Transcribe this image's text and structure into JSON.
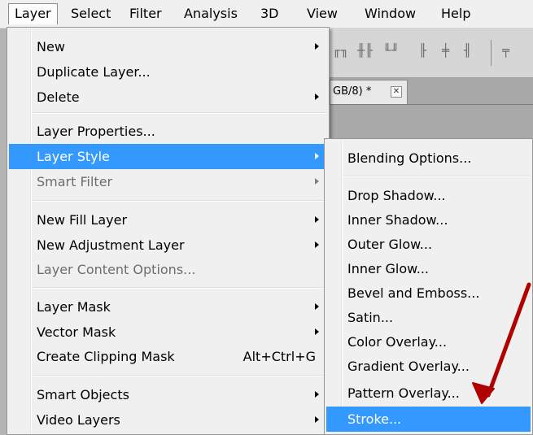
{
  "menubar": {
    "items": [
      "Layer",
      "Select",
      "Filter",
      "Analysis",
      "3D",
      "View",
      "Window",
      "Help"
    ],
    "active": "Layer"
  },
  "document_tab": {
    "title": "GB/8) *",
    "close_symbol": "✕"
  },
  "layer_menu": {
    "items": [
      {
        "label": "New",
        "submenu": true
      },
      {
        "label": "Duplicate Layer..."
      },
      {
        "label": "Delete",
        "submenu": true
      },
      {
        "label": "Layer Properties..."
      },
      {
        "label": "Layer Style",
        "submenu": true,
        "highlighted": true
      },
      {
        "label": "Smart Filter",
        "submenu": true,
        "disabled": true
      },
      {
        "label": "New Fill Layer",
        "submenu": true
      },
      {
        "label": "New Adjustment Layer",
        "submenu": true
      },
      {
        "label": "Layer Content Options...",
        "disabled": true
      },
      {
        "label": "Layer Mask",
        "submenu": true
      },
      {
        "label": "Vector Mask",
        "submenu": true
      },
      {
        "label": "Create Clipping Mask",
        "shortcut": "Alt+Ctrl+G"
      },
      {
        "label": "Smart Objects",
        "submenu": true
      },
      {
        "label": "Video Layers",
        "submenu": true
      }
    ]
  },
  "layer_style_menu": {
    "items": [
      {
        "label": "Blending Options..."
      },
      {
        "label": "Drop Shadow..."
      },
      {
        "label": "Inner Shadow..."
      },
      {
        "label": "Outer Glow..."
      },
      {
        "label": "Inner Glow..."
      },
      {
        "label": "Bevel and Emboss..."
      },
      {
        "label": "Satin..."
      },
      {
        "label": "Color Overlay..."
      },
      {
        "label": "Gradient Overlay..."
      },
      {
        "label": "Pattern Overlay..."
      },
      {
        "label": "Stroke...",
        "highlighted": true
      }
    ]
  },
  "colors": {
    "highlight": "#3399ff",
    "annotation_arrow": "#b00000"
  }
}
